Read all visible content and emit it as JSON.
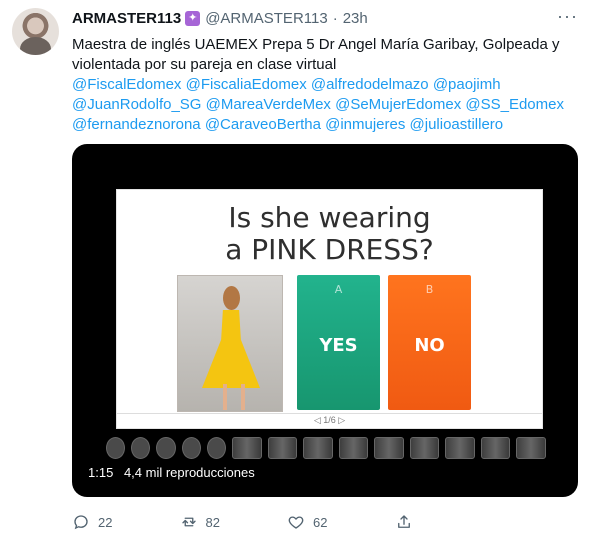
{
  "tweet": {
    "display_name": "ARMASTER113",
    "handle": "@ARMASTER113",
    "time": "23h",
    "more_label": "···",
    "text_lines": [
      "Maestra de inglés UAEMEX Prepa 5 Dr Angel María Garibay, Golpeada y",
      "violentada por su pareja en clase virtual"
    ],
    "mention_lines": [
      "@FiscalEdomex @FiscaliaEdomex @alfredodelmazo @paojimh",
      "@JuanRodolfo_SG @MareaVerdeMex @SeMujerEdomex @SS_Edomex",
      "@fernandeznorona @CaraveoBertha @inmujeres @julioastillero"
    ]
  },
  "video": {
    "slide_title_1": "Is she wearing",
    "slide_title_2": "a PINK DRESS?",
    "option_a_letter": "A",
    "option_a_label": "YES",
    "option_b_letter": "B",
    "option_b_label": "NO",
    "slide_counter": "◁ 1/6 ▷",
    "duration": "1:15",
    "views": "4,4 mil reproducciones"
  },
  "metrics": {
    "replies": "22",
    "retweets": "82",
    "likes": "62"
  },
  "icons": [
    "verified-badge-icon",
    "more-icon",
    "reply-icon",
    "retweet-icon",
    "like-icon",
    "share-icon"
  ],
  "colors": {
    "link": "#1d9bf0",
    "muted": "#536471",
    "yes": "#1fa884",
    "no": "#f6651a"
  }
}
